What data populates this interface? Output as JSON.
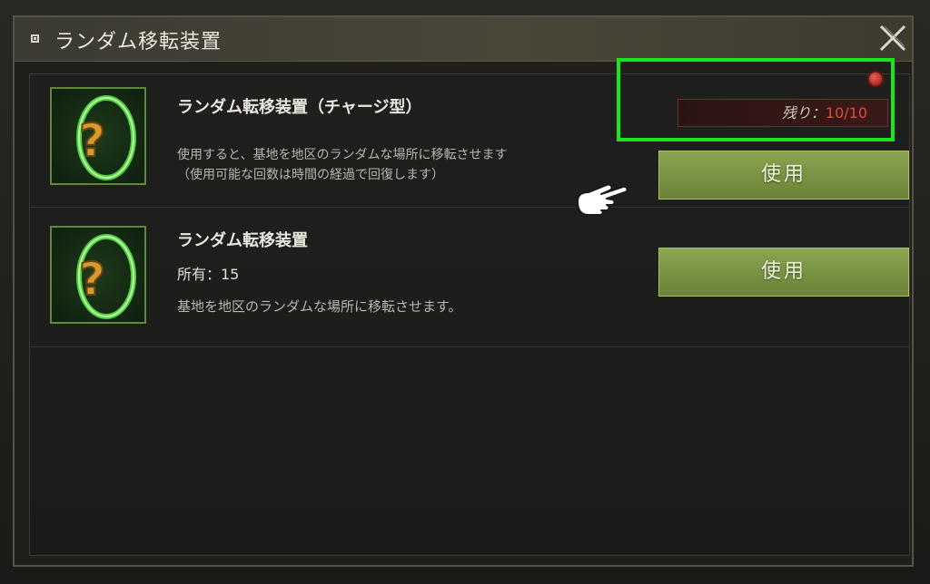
{
  "dialog": {
    "title": "ランダム移転装置"
  },
  "items": [
    {
      "name": "ランダム転移装置（チャージ型）",
      "description_line1": "使用すると、基地を地区のランダムな場所に移転させます",
      "description_line2": "（使用可能な回数は時間の経過で回復します）",
      "remaining_label": "残り：",
      "remaining_value": "10/10",
      "button_label": "使用",
      "icon": "question-portal-icon"
    },
    {
      "name": "ランダム転移装置",
      "owned": "所有：15",
      "description_line1": "基地を地区のランダムな場所に移転させます。",
      "button_label": "使用",
      "icon": "question-portal-icon"
    }
  ],
  "colors": {
    "button_green": "#7b9445",
    "highlight": "#19e61b",
    "remaining_value": "#e3473e",
    "badge_red": "#c0392b"
  }
}
